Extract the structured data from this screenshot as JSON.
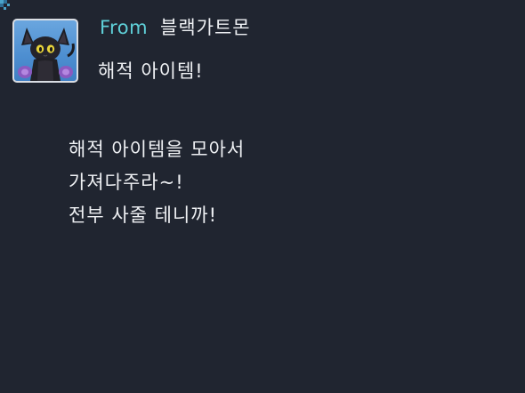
{
  "mail": {
    "from_label": "From",
    "sender_name": "블랙가트몬",
    "subject": "해적 아이템!",
    "body_lines": [
      "해적 아이템을 모아서",
      "가져다주라~!",
      "전부 사줄 테니까!"
    ]
  },
  "colors": {
    "background": "#202530",
    "from_label": "#5fd0d8",
    "text": "#eef0f3",
    "avatar_bg": "#5a98d8",
    "avatar_border": "#d9dde3"
  },
  "icons": {
    "avatar": "black-gatomon-portrait-icon",
    "corner": "corner-pixel-icon"
  }
}
